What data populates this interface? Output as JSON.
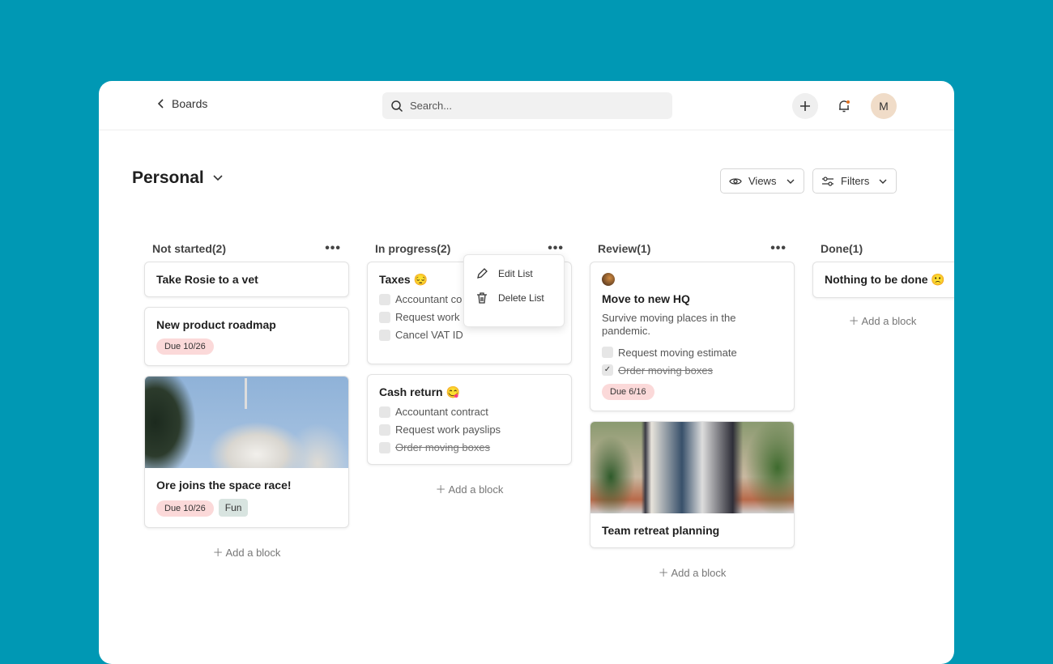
{
  "header": {
    "back_label": "Boards",
    "search_placeholder": "Search...",
    "avatar_initial": "M",
    "notification_dot_color": "#e07020"
  },
  "board": {
    "title": "Personal",
    "views_label": "Views",
    "filters_label": "Filters"
  },
  "add_block_label": "Add a block",
  "context_menu": {
    "items": [
      {
        "label": "Edit List",
        "icon": "pencil-icon"
      },
      {
        "label": "Delete List",
        "icon": "trash-icon"
      }
    ]
  },
  "columns": [
    {
      "title": "Not started(2)",
      "cards": [
        {
          "title": "Take Rosie to a vet"
        },
        {
          "title": "New product roadmap",
          "due": "Due 10/26"
        },
        {
          "title": "Ore joins the space race!",
          "due": "Due 10/26",
          "tag": "Fun",
          "image": "rocket-launch"
        }
      ]
    },
    {
      "title": "In progress(2)",
      "cards": [
        {
          "title": "Taxes 😔",
          "checklist": [
            {
              "text": "Accountant co",
              "done": false
            },
            {
              "text": "Request work",
              "done": false
            },
            {
              "text": "Cancel VAT ID",
              "done": false
            }
          ]
        },
        {
          "title": "Cash return 😋",
          "checklist": [
            {
              "text": "Accountant contract",
              "done": false
            },
            {
              "text": "Request work payslips",
              "done": false
            },
            {
              "text": "Order moving boxes",
              "done": false,
              "struck": true
            }
          ]
        }
      ]
    },
    {
      "title": "Review(1)",
      "cards": [
        {
          "title": "Move to new HQ",
          "description": "Survive moving places in the pandemic.",
          "checklist": [
            {
              "text": "Request moving estimate",
              "done": false
            },
            {
              "text": "Order moving boxes",
              "done": true
            }
          ],
          "due": "Due 6/16"
        },
        {
          "title": "Team retreat planning",
          "image": "team-jumping"
        }
      ]
    },
    {
      "title": "Done(1)",
      "cards": [
        {
          "title": "Nothing to be done 🙁"
        }
      ]
    }
  ]
}
